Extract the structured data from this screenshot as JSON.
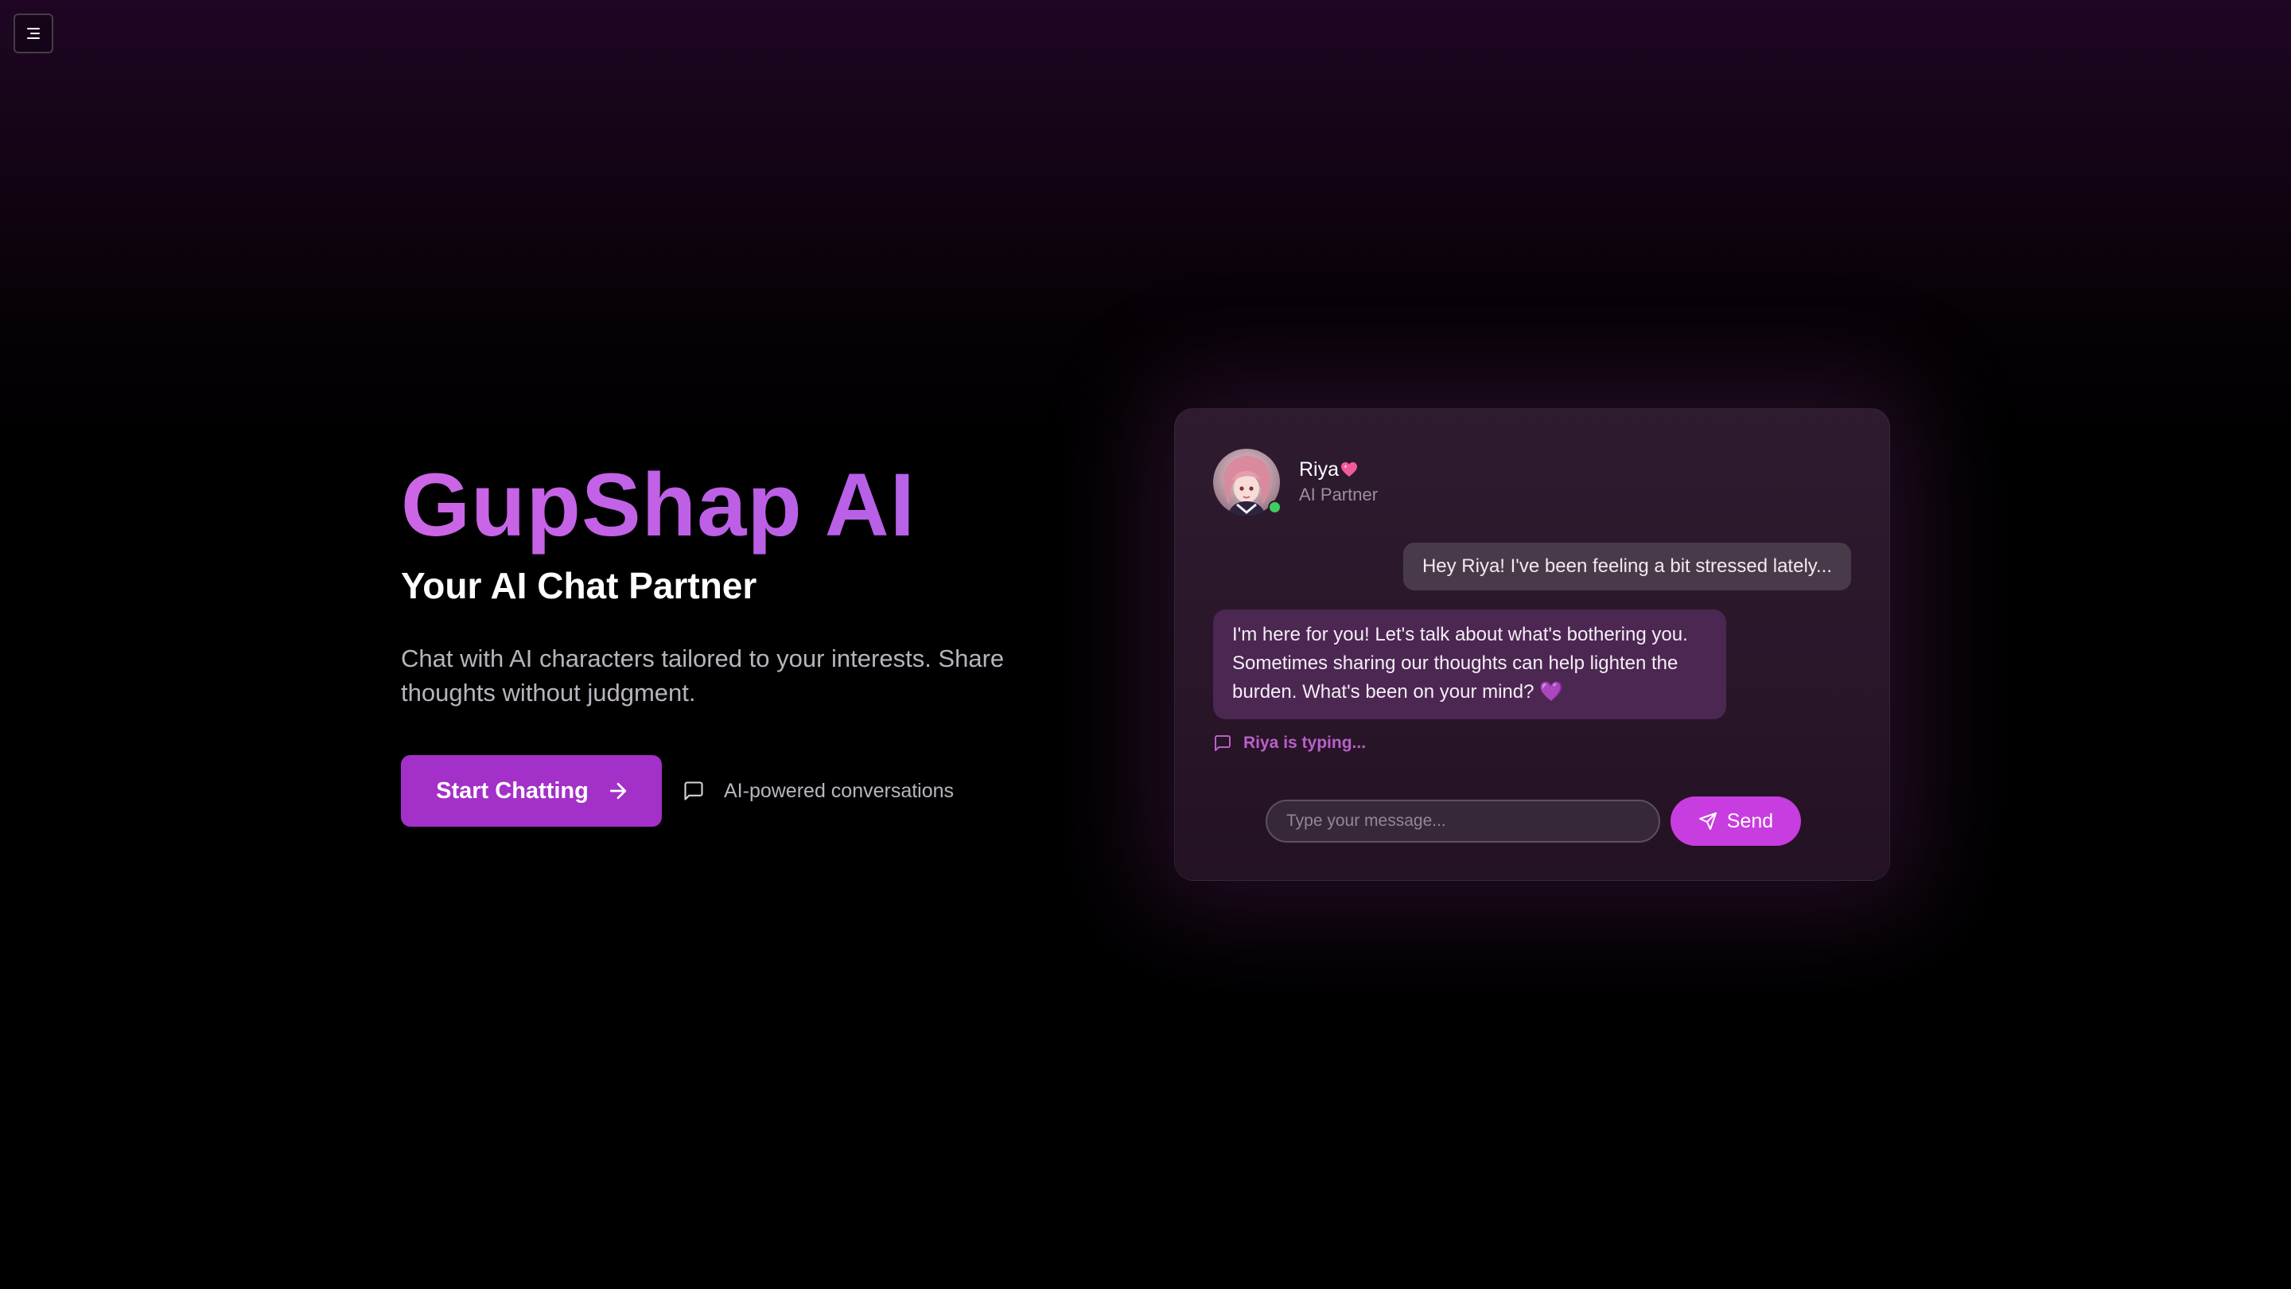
{
  "app": {
    "menu_icon": "menu-icon"
  },
  "hero": {
    "title": "GupShap AI",
    "subtitle": "Your AI Chat Partner",
    "description": "Chat with AI characters tailored to your interests. Share thoughts without judgment.",
    "cta_label": "Start Chatting",
    "cta_icon": "arrow-right-icon",
    "feature_icon": "message-square-icon",
    "feature_label": "AI-powered conversations"
  },
  "chat": {
    "character": {
      "name": "Riya",
      "name_emoji": "heart-icon",
      "role": "AI Partner",
      "status": "online"
    },
    "messages": [
      {
        "from": "user",
        "text": "Hey Riya! I've been feeling a bit stressed lately..."
      },
      {
        "from": "ai",
        "text": "I'm here for you! Let's talk about what's bothering you. Sometimes sharing our thoughts can help lighten the burden. What's been on your mind? 💜"
      }
    ],
    "typing_text": "Riya is typing...",
    "input_placeholder": "Type your message...",
    "send_label": "Send",
    "send_icon": "send-icon"
  },
  "colors": {
    "accent": "#a330c8",
    "send": "#c83ddf",
    "title_gradient_start": "#cd66e6",
    "title_gradient_end": "#b464ea",
    "online": "#3ccf5e"
  }
}
